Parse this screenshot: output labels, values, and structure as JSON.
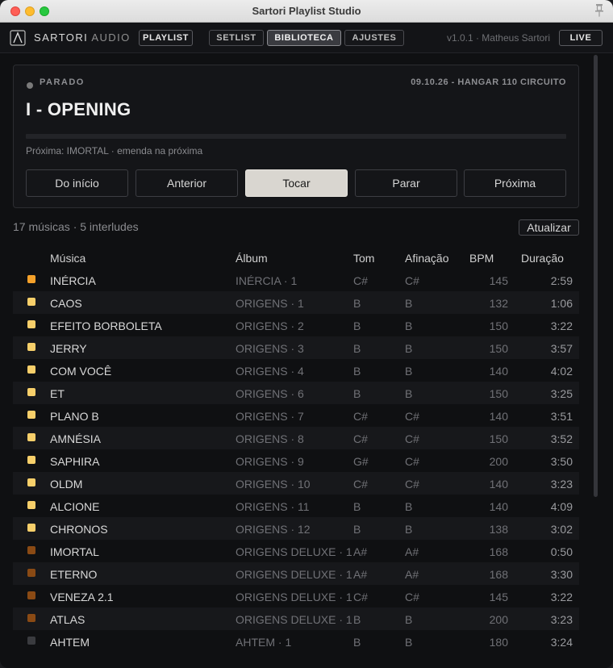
{
  "window": {
    "title": "Sartori Playlist Studio"
  },
  "header": {
    "brand_main": "SARTORI",
    "brand_light": "AUDIO",
    "mode_label": "PLAYLIST",
    "tabs": [
      {
        "label": "SETLIST",
        "active": false
      },
      {
        "label": "BIBLIOTECA",
        "active": true
      },
      {
        "label": "AJUSTES",
        "active": false
      }
    ],
    "version": "v1.0.1 · Matheus Sartori",
    "live_label": "LIVE"
  },
  "player": {
    "status": "PARADO",
    "event": "09.10.26 - HANGAR 110 CIRCUITO",
    "track_title": "I - OPENING",
    "progress": 0,
    "next": "Próxima: IMORTAL · emenda na próxima",
    "controls": [
      {
        "label": "Do início",
        "active": false
      },
      {
        "label": "Anterior",
        "active": false
      },
      {
        "label": "Tocar",
        "active": true
      },
      {
        "label": "Parar",
        "active": false
      },
      {
        "label": "Próxima",
        "active": false
      }
    ]
  },
  "library": {
    "counts": "17 músicas · 5 interludes",
    "refresh_label": "Atualizar",
    "columns": [
      "Música",
      "Álbum",
      "Tom",
      "Afinação",
      "BPM",
      "Duração"
    ],
    "rows": [
      {
        "color": "#f5a12a",
        "name": "INÉRCIA",
        "album": "INÉRCIA · 1",
        "key": "C#",
        "tuning": "C#",
        "bpm": "145",
        "duration": "2:59"
      },
      {
        "color": "#f7cf6a",
        "name": "CAOS",
        "album": "ORIGENS · 1",
        "key": "B",
        "tuning": "B",
        "bpm": "132",
        "duration": "1:06"
      },
      {
        "color": "#f7cf6a",
        "name": "EFEITO BORBOLETA",
        "album": "ORIGENS · 2",
        "key": "B",
        "tuning": "B",
        "bpm": "150",
        "duration": "3:22"
      },
      {
        "color": "#f7cf6a",
        "name": "JERRY",
        "album": "ORIGENS · 3",
        "key": "B",
        "tuning": "B",
        "bpm": "150",
        "duration": "3:57"
      },
      {
        "color": "#f7cf6a",
        "name": "COM VOCÊ",
        "album": "ORIGENS · 4",
        "key": "B",
        "tuning": "B",
        "bpm": "140",
        "duration": "4:02"
      },
      {
        "color": "#f7cf6a",
        "name": "ET",
        "album": "ORIGENS · 6",
        "key": "B",
        "tuning": "B",
        "bpm": "150",
        "duration": "3:25"
      },
      {
        "color": "#f7cf6a",
        "name": "PLANO B",
        "album": "ORIGENS · 7",
        "key": "C#",
        "tuning": "C#",
        "bpm": "140",
        "duration": "3:51"
      },
      {
        "color": "#f7cf6a",
        "name": "AMNÉSIA",
        "album": "ORIGENS · 8",
        "key": "C#",
        "tuning": "C#",
        "bpm": "150",
        "duration": "3:52"
      },
      {
        "color": "#f7cf6a",
        "name": "SAPHIRA",
        "album": "ORIGENS · 9",
        "key": "G#",
        "tuning": "C#",
        "bpm": "200",
        "duration": "3:50"
      },
      {
        "color": "#f7cf6a",
        "name": "OLDM",
        "album": "ORIGENS · 10",
        "key": "C#",
        "tuning": "C#",
        "bpm": "140",
        "duration": "3:23"
      },
      {
        "color": "#f7cf6a",
        "name": "ALCIONE",
        "album": "ORIGENS · 11",
        "key": "B",
        "tuning": "B",
        "bpm": "140",
        "duration": "4:09"
      },
      {
        "color": "#f7cf6a",
        "name": "CHRONOS",
        "album": "ORIGENS · 12",
        "key": "B",
        "tuning": "B",
        "bpm": "138",
        "duration": "3:02"
      },
      {
        "color": "#8a4a14",
        "name": "IMORTAL",
        "album": "ORIGENS DELUXE · 1",
        "key": "A#",
        "tuning": "A#",
        "bpm": "168",
        "duration": "0:50"
      },
      {
        "color": "#8a4a14",
        "name": "ETERNO",
        "album": "ORIGENS DELUXE · 1",
        "key": "A#",
        "tuning": "A#",
        "bpm": "168",
        "duration": "3:30"
      },
      {
        "color": "#8a4a14",
        "name": "VENEZA 2.1",
        "album": "ORIGENS DELUXE · 1",
        "key": "C#",
        "tuning": "C#",
        "bpm": "145",
        "duration": "3:22"
      },
      {
        "color": "#8a4a14",
        "name": "ATLAS",
        "album": "ORIGENS DELUXE · 1",
        "key": "B",
        "tuning": "B",
        "bpm": "200",
        "duration": "3:23"
      },
      {
        "color": "#3a3b3f",
        "name": "AHTEM",
        "album": "AHTEM · 1",
        "key": "B",
        "tuning": "B",
        "bpm": "180",
        "duration": "3:24"
      }
    ]
  }
}
